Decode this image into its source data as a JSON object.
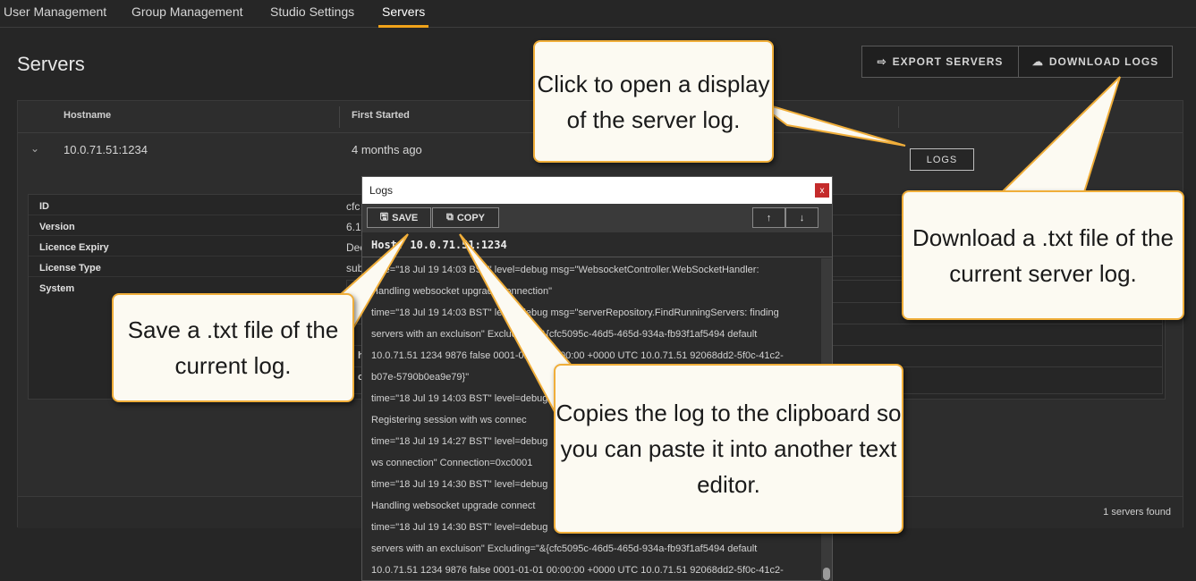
{
  "nav": {
    "tabs": [
      {
        "label": "User Management"
      },
      {
        "label": "Group Management"
      },
      {
        "label": "Studio Settings"
      },
      {
        "label": "Servers"
      }
    ]
  },
  "page": {
    "title": "Servers",
    "export_label": "EXPORT SERVERS",
    "download_label": "DOWNLOAD LOGS"
  },
  "table": {
    "columns": [
      "Hostname",
      "First Started"
    ],
    "row": {
      "hostname": "10.0.71.51:1234",
      "first_started": "4 months ago",
      "logs_label": "LOGS"
    },
    "details": [
      {
        "label": "ID",
        "value": "cfc"
      },
      {
        "label": "Version",
        "value": "6.1."
      },
      {
        "label": "Licence Expiry",
        "value": "Dec"
      },
      {
        "label": "License Type",
        "value": "sub"
      },
      {
        "label": "System",
        "value": ""
      }
    ],
    "system_rows": [
      "o",
      "q",
      "",
      "h",
      "c"
    ],
    "footer": "1 servers found"
  },
  "dialog": {
    "title": "Logs",
    "close": "x",
    "save_label": "SAVE",
    "copy_label": "COPY",
    "up": "↑",
    "down": "↓",
    "host": "Host: 10.0.71.51:1234",
    "lines": [
      "time=\"18 Jul 19 14:03 BST\" level=debug msg=\"WebsocketController.WebSocketHandler:",
      "Handling websocket upgrade connection\"",
      "time=\"18 Jul 19 14:03 BST\" level=debug msg=\"serverRepository.FindRunningServers: finding",
      "servers with an excluison\" Excluding=\"&{cfc5095c-46d5-465d-934a-fb93f1af5494 default",
      "10.0.71.51 1234 9876 false 0001-01-01 00:00:00 +0000 UTC 10.0.71.51 92068dd2-5f0c-41c2-",
      "b07e-5790b0ea9e79}\"",
      "time=\"18 Jul 19 14:03 BST\" level=debug",
      "Registering session with ws connec",
      "time=\"18 Jul 19 14:27 BST\" level=debug",
      "ws connection\" Connection=0xc0001",
      "time=\"18 Jul 19 14:30 BST\" level=debug",
      "Handling websocket upgrade connect",
      "time=\"18 Jul 19 14:30 BST\" level=debug",
      "servers with an excluison\" Excluding=\"&{cfc5095c-46d5-465d-934a-fb93f1af5494 default",
      "10.0.71.51 1234 9876 false 0001-01-01 00:00:00 +0000 UTC 10.0.71.51 92068dd2-5f0c-41c2-"
    ]
  },
  "callouts": {
    "open_log": "Click to open a display of the server log.",
    "download": "Download a .txt file of the current server log.",
    "save": "Save a .txt file of the current log.",
    "copy": "Copies the log to the clipboard so you can paste it into another text editor."
  }
}
